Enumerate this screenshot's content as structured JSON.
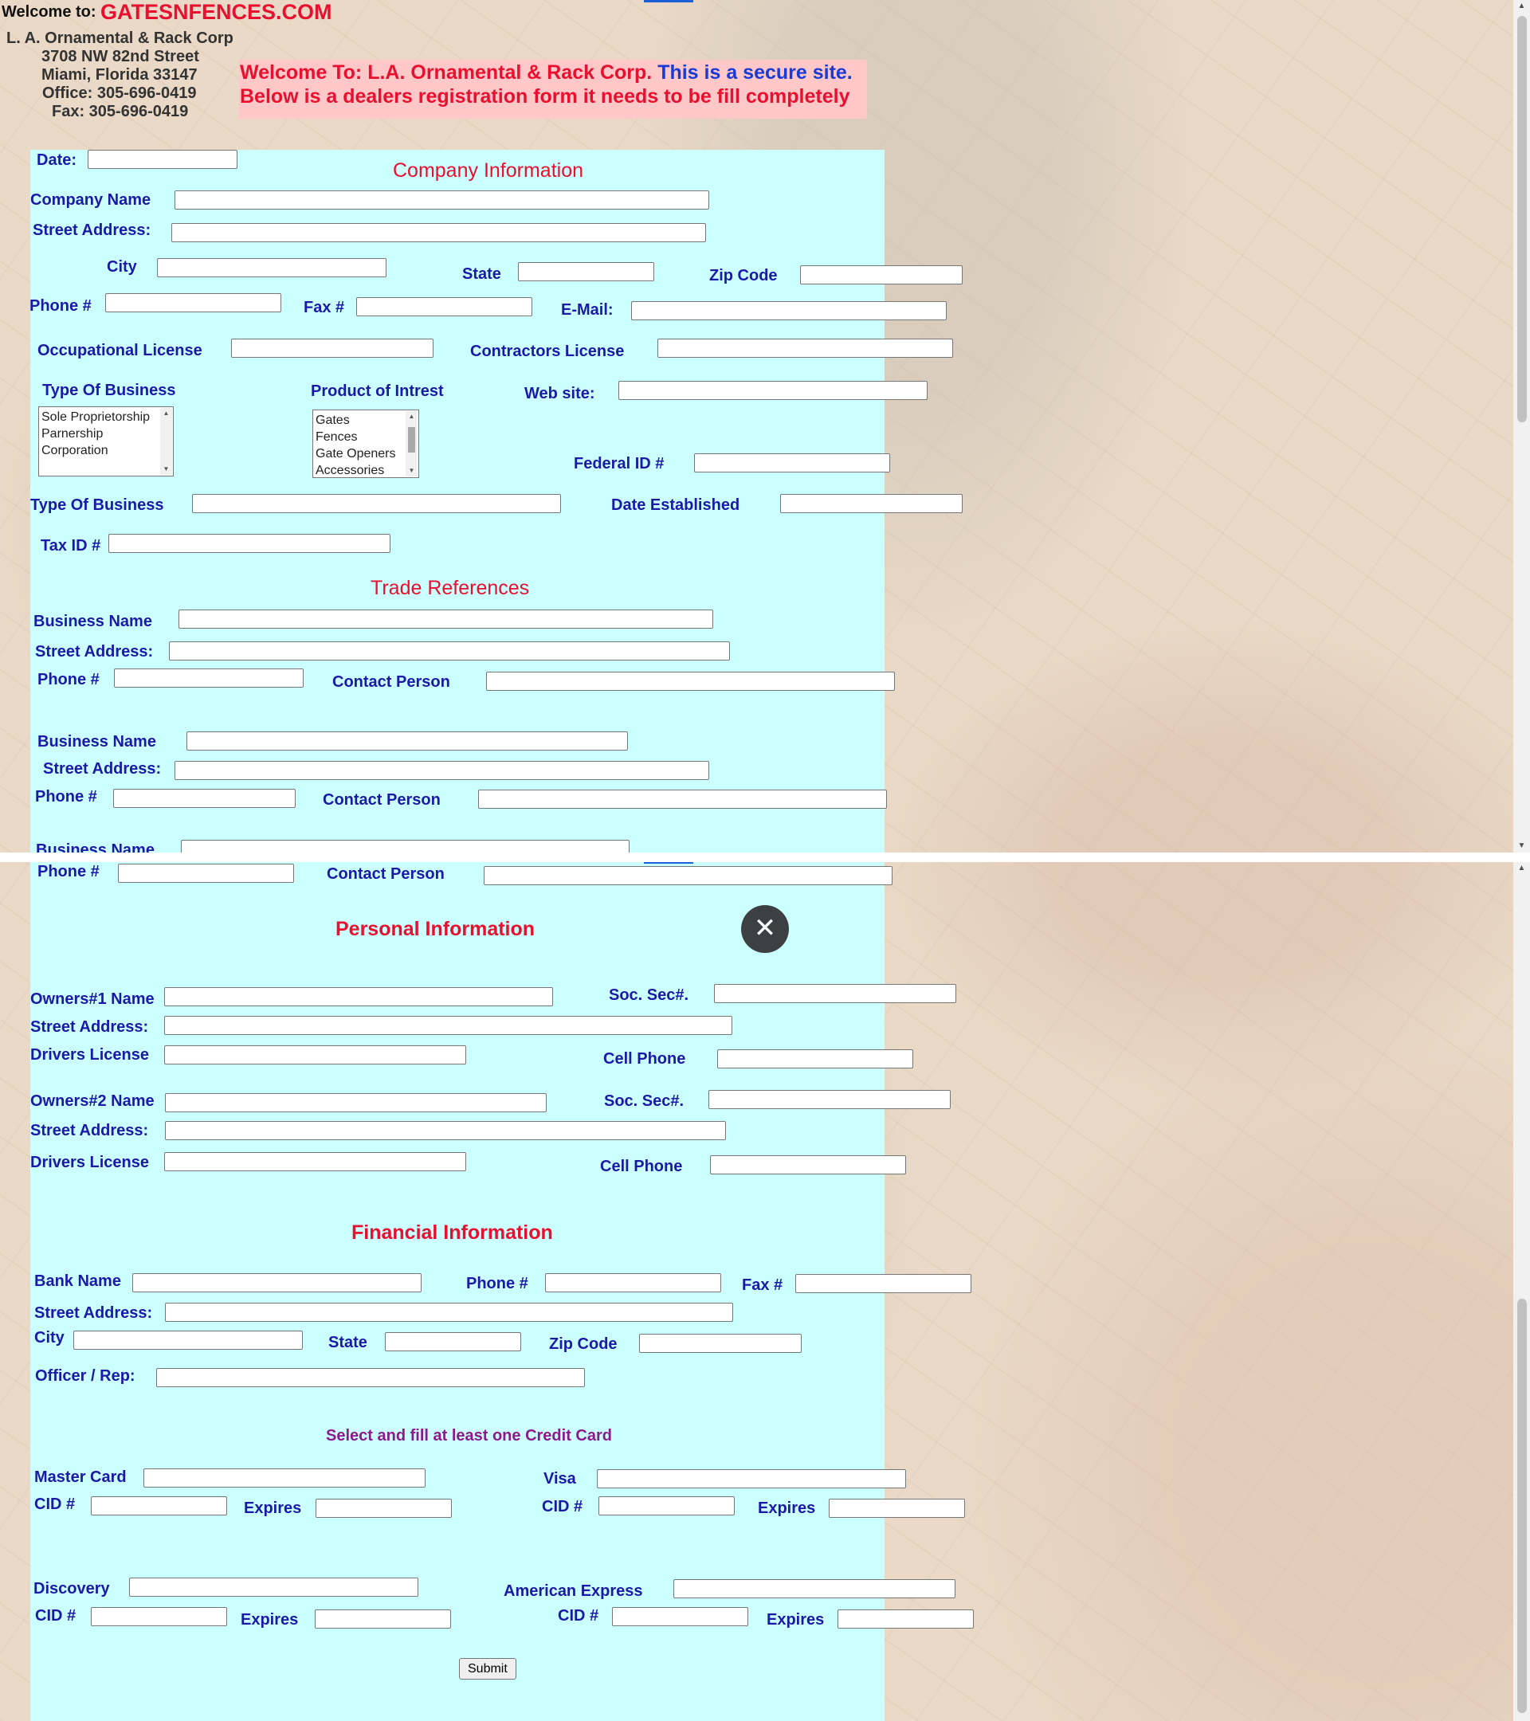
{
  "header": {
    "welcome_prefix": "Welcome to:",
    "site_name": "GATESNFENCES.COM",
    "company": "L. A. Ornamental & Rack Corp",
    "street": "3708 NW 82nd Street",
    "city_state": "Miami, Florida 33147",
    "office": "Office: 305-696-0419",
    "fax": "Fax: 305-696-0419"
  },
  "banner": {
    "line1_a": "Welcome To: L.A. Ornamental & Rack Corp.",
    "line1_b": "This is a secure site.",
    "line2": "Below is a dealers registration form it needs to be fill completely"
  },
  "company_info": {
    "title": "Company Information",
    "date": "Date:",
    "company_name": "Company Name",
    "street_address": "Street Address:",
    "city": "City",
    "state": "State",
    "zip": "Zip Code",
    "phone": "Phone #",
    "fax": "Fax #",
    "email": "E-Mail:",
    "occupational_license": "Occupational License",
    "contractors_license": "Contractors License",
    "type_of_business": "Type Of Business",
    "product_of_interest": "Product of Intrest",
    "web_site": "Web site:",
    "federal_id": "Federal ID #",
    "type_of_business_2": "Type Of Business",
    "date_established": "Date Established",
    "tax_id": "Tax ID #",
    "business_types": [
      "Sole Proprietorship",
      "Parnership",
      "Corporation"
    ],
    "products": [
      "Gates",
      "Fences",
      "Gate Openers",
      "Accessories"
    ]
  },
  "trade_refs": {
    "title": "Trade References",
    "business_name": "Business Name",
    "street_address": "Street Address:",
    "phone": "Phone #",
    "contact_person": "Contact Person"
  },
  "personal_info": {
    "title": "Personal Information",
    "owner1": "Owners#1 Name",
    "owner2": "Owners#2 Name",
    "ssn": "Soc. Sec#.",
    "street_address": "Street Address:",
    "drivers_license": "Drivers License",
    "cell_phone": "Cell Phone"
  },
  "financial_info": {
    "title": "Financial Information",
    "bank_name": "Bank Name",
    "phone": "Phone #",
    "fax": "Fax #",
    "street_address": "Street Address:",
    "city": "City",
    "state": "State",
    "zip": "Zip Code",
    "officer": "Officer / Rep:",
    "credit_card_note": "Select and fill at least one Credit Card",
    "master_card": "Master Card",
    "visa": "Visa",
    "discovery": "Discovery",
    "amex": "American Express",
    "cid": "CID #",
    "expires": "Expires"
  },
  "submit_label": "Submit",
  "close_symbol": "✕",
  "colors": {
    "panel_bg": "#ccffff",
    "label": "#1a1aa6",
    "title_red": "#e8102e",
    "note_purple": "#8b1a8b",
    "banner_bg": "#ffc8c8"
  }
}
